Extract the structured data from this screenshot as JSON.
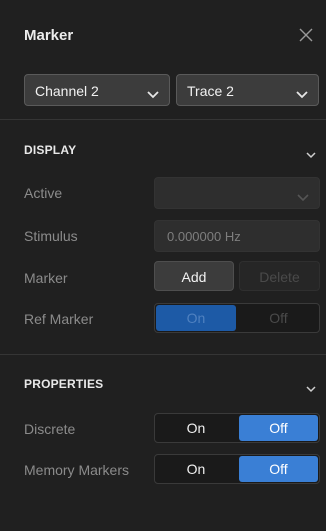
{
  "panel": {
    "title": "Marker",
    "close_icon": "close-icon"
  },
  "selects": {
    "channel": "Channel 2",
    "trace": "Trace 2"
  },
  "display": {
    "title": "DISPLAY",
    "active_label": "Active",
    "active_value": "",
    "stimulus_label": "Stimulus",
    "stimulus_value": "0.000000 Hz",
    "marker_label": "Marker",
    "add_label": "Add",
    "delete_label": "Delete",
    "ref_marker_label": "Ref Marker",
    "ref_on": "On",
    "ref_off": "Off"
  },
  "properties": {
    "title": "PROPERTIES",
    "discrete_label": "Discrete",
    "discrete_on": "On",
    "discrete_off": "Off",
    "memory_label": "Memory Markers",
    "memory_on": "On",
    "memory_off": "Off"
  },
  "colors": {
    "accent": "#3a7fd5",
    "accent_dim": "#1d5aa6",
    "background": "#202020"
  }
}
